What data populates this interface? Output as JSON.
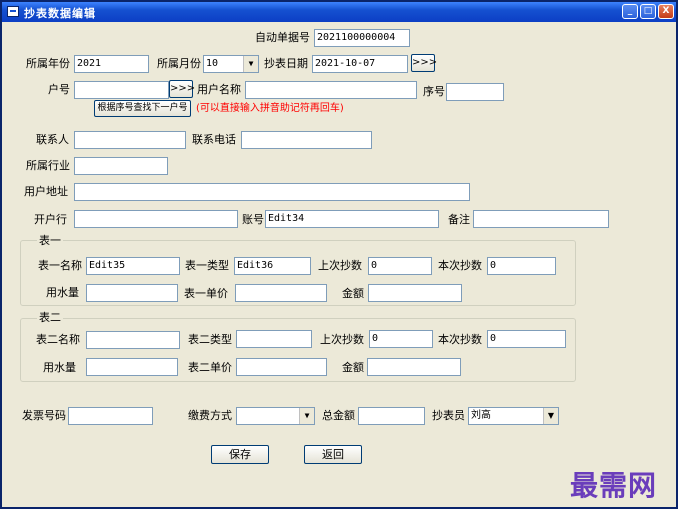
{
  "window": {
    "title": "抄表数据编辑"
  },
  "titlebar_buttons": {
    "minimize": "_",
    "restore": "□",
    "close": "X"
  },
  "form": {
    "auto_no_label": "自动单据号",
    "auto_no_value": "2021100000004",
    "year_label": "所属年份",
    "year_value": "2021",
    "month_label": "所属月份",
    "month_value": "10",
    "date_label": "抄表日期",
    "date_value": "2021-10-07",
    "more_button": ">>>",
    "account_label": "户号",
    "account_value": "",
    "username_label": "用户名称",
    "username_value": "",
    "seq_label": "序号",
    "seq_value": "",
    "find_next_button": "根据序号查找下一户号",
    "hint": "(可以直接输入拼音助记符再回车)",
    "contact_label": "联系人",
    "contact_value": "",
    "phone_label": "联系电话",
    "phone_value": "",
    "industry_label": "所属行业",
    "industry_value": "",
    "address_label": "用户地址",
    "address_value": "",
    "bank_label": "开户行",
    "bank_value": "",
    "acct_no_label": "账号",
    "acct_no_value": "Edit34",
    "remark_label": "备注",
    "remark_value": ""
  },
  "meter1": {
    "group_label": "表一",
    "name_label": "表一名称",
    "name_value": "Edit35",
    "type_label": "表一类型",
    "type_value": "Edit36",
    "last_label": "上次抄数",
    "last_value": "0",
    "current_label": "本次抄数",
    "current_value": "0",
    "usage_label": "用水量",
    "usage_value": "",
    "price_label": "表一单价",
    "price_value": "",
    "amount_label": "金额",
    "amount_value": ""
  },
  "meter2": {
    "group_label": "表二",
    "name_label": "表二名称",
    "name_value": "",
    "type_label": "表二类型",
    "type_value": "",
    "last_label": "上次抄数",
    "last_value": "0",
    "current_label": "本次抄数",
    "current_value": "0",
    "usage_label": "用水量",
    "usage_value": "",
    "price_label": "表二单价",
    "price_value": "",
    "amount_label": "金额",
    "amount_value": ""
  },
  "footer": {
    "invoice_label": "发票号码",
    "invoice_value": "",
    "payment_label": "缴费方式",
    "payment_value": "",
    "total_label": "总金额",
    "total_value": "",
    "reader_label": "抄表员",
    "reader_value": "刘高"
  },
  "actions": {
    "save": "保存",
    "back": "返回"
  },
  "icons": {
    "dropdown": "▼"
  },
  "watermark": "最需网"
}
